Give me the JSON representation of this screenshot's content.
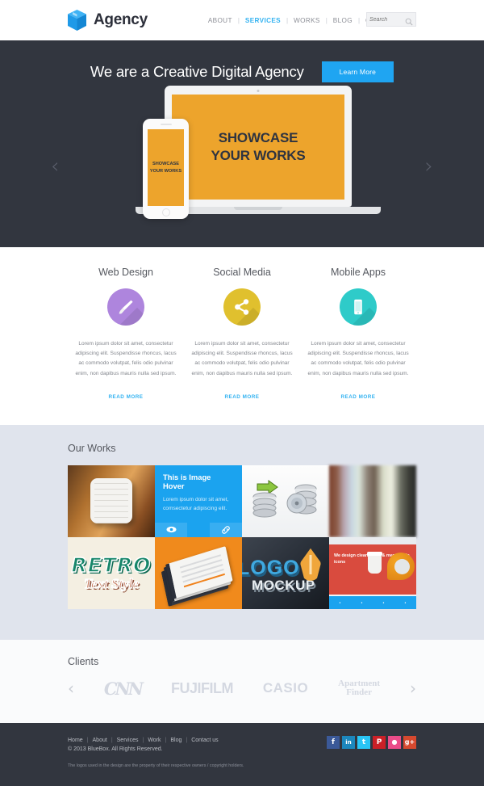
{
  "header": {
    "brand": "Agency",
    "logo_icon": "cube-icon",
    "nav": [
      {
        "label": "ABOUT",
        "active": false
      },
      {
        "label": "SERVICES",
        "active": true
      },
      {
        "label": "WORKS",
        "active": false
      },
      {
        "label": "BLOG",
        "active": false
      },
      {
        "label": "CONTACT US",
        "active": false
      }
    ],
    "separator": "|",
    "search": {
      "placeholder": "Search",
      "value": "",
      "icon": "search-icon"
    }
  },
  "hero": {
    "title": "We are a Creative Digital Agency",
    "button": "Learn More",
    "prev_arrow": "‹",
    "next_arrow": "›",
    "laptop_screen_line1": "SHOWCASE",
    "laptop_screen_line2": "YOUR WORKS",
    "phone_screen_line1": "SHOWCASE",
    "phone_screen_line2": "YOUR WORKS",
    "bg_color": "#32363f",
    "screen_color": "#eda42c",
    "accent": "#1fa5f2"
  },
  "services": {
    "items": [
      {
        "title": "Web Design",
        "icon": "paintbrush-icon",
        "color": "#ae85dd",
        "text": "Lorem ipsum dolor sit amet, consectetur adipiscing elit. Suspendisse rhoncus, lacus ac commodo volutpat, felis odio pulvinar enim, non dapibus mauris nulla sed ipsum.",
        "more": "READ MORE"
      },
      {
        "title": "Social Media",
        "icon": "share-icon",
        "color": "#e0c02e",
        "text": "Lorem ipsum dolor sit amet, consectetur adipiscing elit. Suspendisse rhoncus, lacus ac commodo volutpat, felis odio pulvinar enim, non dapibus mauris nulla sed ipsum.",
        "more": "READ MORE"
      },
      {
        "title": "Mobile Apps",
        "icon": "mobile-phone-icon",
        "color": "#2ecbc9",
        "text": "Lorem ipsum dolor sit amet, consectetur adipiscing elit. Suspendisse rhoncus, lacus ac commodo volutpat, felis odio pulvinar enim, non dapibus mauris nulla sed ipsum.",
        "more": "READ MORE"
      }
    ]
  },
  "works": {
    "title": "Our Works",
    "hover": {
      "title": "This is Image Hover",
      "text": "Lorem ipsum dolor sit amet, comsectetur adipiscing elit.",
      "zoom_icon": "eye-icon",
      "link_icon": "link-icon"
    },
    "items": [
      {
        "name": "notebook-app-icon"
      },
      {
        "name": "image-hover-overlay"
      },
      {
        "name": "database-backup-icons"
      },
      {
        "name": "blurred-color-stripes"
      },
      {
        "name": "retro-text-style"
      },
      {
        "name": "business-card-mockup"
      },
      {
        "name": "logo-mockup"
      },
      {
        "name": "web-template-preview"
      }
    ],
    "retro_line1": "RETRO",
    "retro_line2": "Text Style",
    "logo_line1": "LOGO",
    "logo_line2": "MOCKUP",
    "web_caption": "We design clean, crisp & memorable icons",
    "bg_color": "#e0e4ed"
  },
  "clients": {
    "title": "Clients",
    "prev_arrow": "‹",
    "next_arrow": "›",
    "logos": [
      {
        "name": "cnn-logo",
        "text": "CNN"
      },
      {
        "name": "fujifilm-logo",
        "text": "FUJIFILM"
      },
      {
        "name": "casio-logo",
        "text": "CASIO"
      },
      {
        "name": "apartment-finder-logo",
        "line1": "Apartment",
        "line2": "Finder"
      }
    ]
  },
  "footer": {
    "links": [
      "Home",
      "About",
      "Services",
      "Work",
      "Blog",
      "Contact us"
    ],
    "separator": "|",
    "copyright": "© 2013 BlueBox. All Rights Reserved.",
    "note": "The logos used in the design are the property of their respective owners / copyright holders.",
    "socials": [
      {
        "name": "facebook-icon",
        "glyph": "f",
        "color": "#3b5998"
      },
      {
        "name": "linkedin-icon",
        "glyph": "in",
        "color": "#1c87bd"
      },
      {
        "name": "twitter-icon",
        "glyph": "t",
        "color": "#29c5f6"
      },
      {
        "name": "pinterest-icon",
        "glyph": "P",
        "color": "#cb2027"
      },
      {
        "name": "dribbble-icon",
        "glyph": "●",
        "color": "#ea4c89"
      },
      {
        "name": "googleplus-icon",
        "glyph": "g+",
        "color": "#d6492f"
      }
    ]
  }
}
